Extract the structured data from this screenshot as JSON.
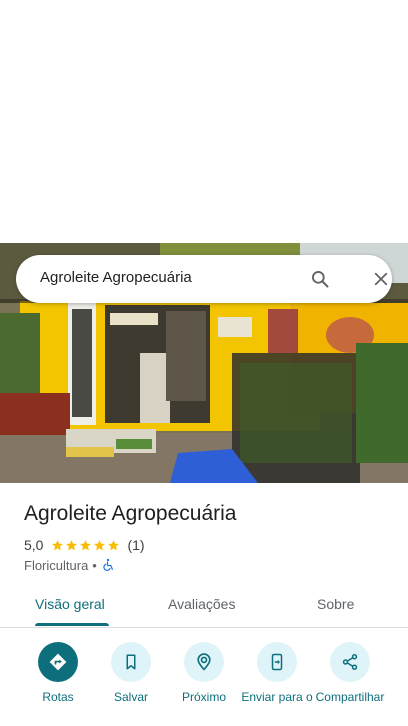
{
  "search": {
    "query": "Agroleite Agropecuária"
  },
  "place": {
    "name": "Agroleite Agropecuária",
    "rating": "5,0",
    "stars": 5,
    "review_count": "(1)",
    "category": "Floricultura",
    "separator": "•",
    "accessibility_icon": "wheelchair-icon"
  },
  "tabs": [
    {
      "label": "Visão geral",
      "active": true
    },
    {
      "label": "Avaliações",
      "active": false
    },
    {
      "label": "Sobre",
      "active": false
    }
  ],
  "actions": [
    {
      "label": "Rotas",
      "icon": "directions-icon"
    },
    {
      "label": "Salvar",
      "icon": "bookmark-icon"
    },
    {
      "label": "Próximo",
      "icon": "nearby-icon"
    },
    {
      "label": "Enviar para o",
      "icon": "send-to-phone-icon"
    },
    {
      "label": "Compartilhar",
      "icon": "share-icon"
    }
  ],
  "colors": {
    "accent": "#0e6f7c",
    "action_bg": "#dff4f8",
    "star": "#fbbc04",
    "storefront_yellow": "#f2c500"
  }
}
